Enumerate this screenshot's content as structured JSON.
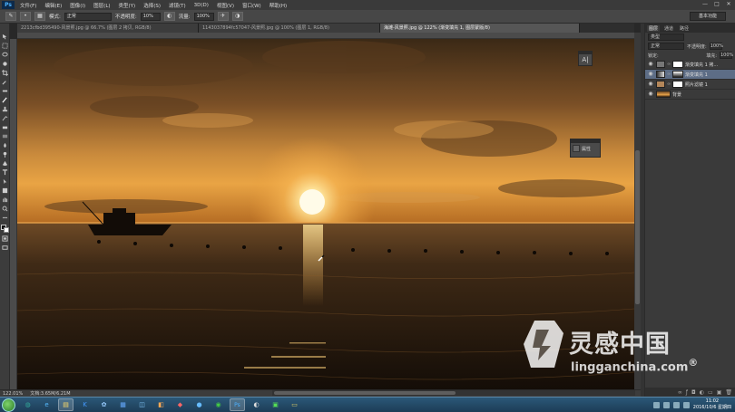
{
  "app": {
    "logo": "Ps"
  },
  "menu": {
    "items": [
      "文件(F)",
      "编辑(E)",
      "图像(I)",
      "图层(L)",
      "类型(Y)",
      "选择(S)",
      "滤镜(T)",
      "3D(D)",
      "视图(V)",
      "窗口(W)",
      "帮助(H)"
    ]
  },
  "window_controls": {
    "minimize": "—",
    "maximize": "□",
    "close": "✕"
  },
  "options": {
    "mode_label": "模式:",
    "mode_value": "正常",
    "opacity_label": "不透明度:",
    "opacity_value": "10%",
    "flow_label": "流量:",
    "flow_value": "100%",
    "workspace": "基本功能"
  },
  "tabs": [
    {
      "label": "2213cfbd395490-风景照.jpg @ 66.7% (图层 2 拷贝, RGB/8)",
      "active": false
    },
    {
      "label": "1143037894fc57047-风景照.jpg @ 100% (图层 1, RGB/8)",
      "active": false
    },
    {
      "label": "海滩-风景照.jpg @ 122% (渐变填充 1, 图层蒙版/8)",
      "active": true
    }
  ],
  "panel": {
    "tabs": [
      "图层",
      "通道",
      "路径"
    ],
    "kind_label": "类型",
    "blend_value": "正常",
    "opacity_label": "不透明度:",
    "opacity_value": "100%",
    "lock_label": "锁定:",
    "fill_label": "填充:",
    "fill_value": "100%",
    "layers": [
      {
        "name": "渐变填充 1 拷...",
        "selected": false
      },
      {
        "name": "渐变填充 1",
        "selected": true
      },
      {
        "name": "照片滤镜 1",
        "selected": false
      },
      {
        "name": "背景",
        "selected": false
      }
    ]
  },
  "float_char": {
    "glyph": "A|"
  },
  "float_prop": {
    "label": "属性"
  },
  "status": {
    "zoom": "122.01%",
    "doc": "文档:3.65M/6.21M"
  },
  "taskbar": {
    "clock_time": "11:02",
    "clock_date": "2016/10/6 星期四"
  },
  "watermark": {
    "cn": "灵感中国",
    "en": "lingganchina.com",
    "reg": "®"
  },
  "colors": {
    "sky_top": "#3a2a18",
    "sun": "#fff3c0",
    "horizon": "#f2a23c",
    "sea": "#1a120a"
  }
}
